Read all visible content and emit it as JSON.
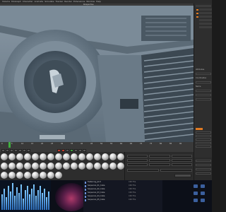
{
  "menubar": {
    "items": [
      "Volume",
      "MoGraph",
      "Character",
      "Animate",
      "Simulate",
      "Tracker",
      "Render",
      "Extensions",
      "Window",
      "Help"
    ]
  },
  "viewport": {
    "title": "Perspective"
  },
  "attributes": {
    "field_labels": [
      "Attributes",
      "Coordinates",
      "Name"
    ]
  },
  "timeline": {
    "ruler": [
      "0",
      "5",
      "10",
      "15",
      "20",
      "25",
      "30",
      "35",
      "40",
      "45",
      "50",
      "55",
      "60",
      "65",
      "70",
      "75",
      "80",
      "85",
      "90"
    ]
  },
  "materials": {
    "ball_count": 32
  },
  "taskbar": {
    "files": [
      {
        "name": "Fastening_Joint",
        "meta": "C4D File"
      },
      {
        "name": "Sequence_01_Cube",
        "meta": "C4D File"
      },
      {
        "name": "Sequence_02_Cube",
        "meta": "C4D File"
      },
      {
        "name": "Sequence_03_Cube",
        "meta": "C4D File"
      },
      {
        "name": "Sequence_04_Cube",
        "meta": "C4D File"
      },
      {
        "name": "Sequence_05_Cube",
        "meta": "C4D File"
      }
    ]
  },
  "colors": {
    "accent_orange": "#e07a22",
    "viewport_steel": "#6b7c8a",
    "eq_blue": "#7fc8ff"
  }
}
